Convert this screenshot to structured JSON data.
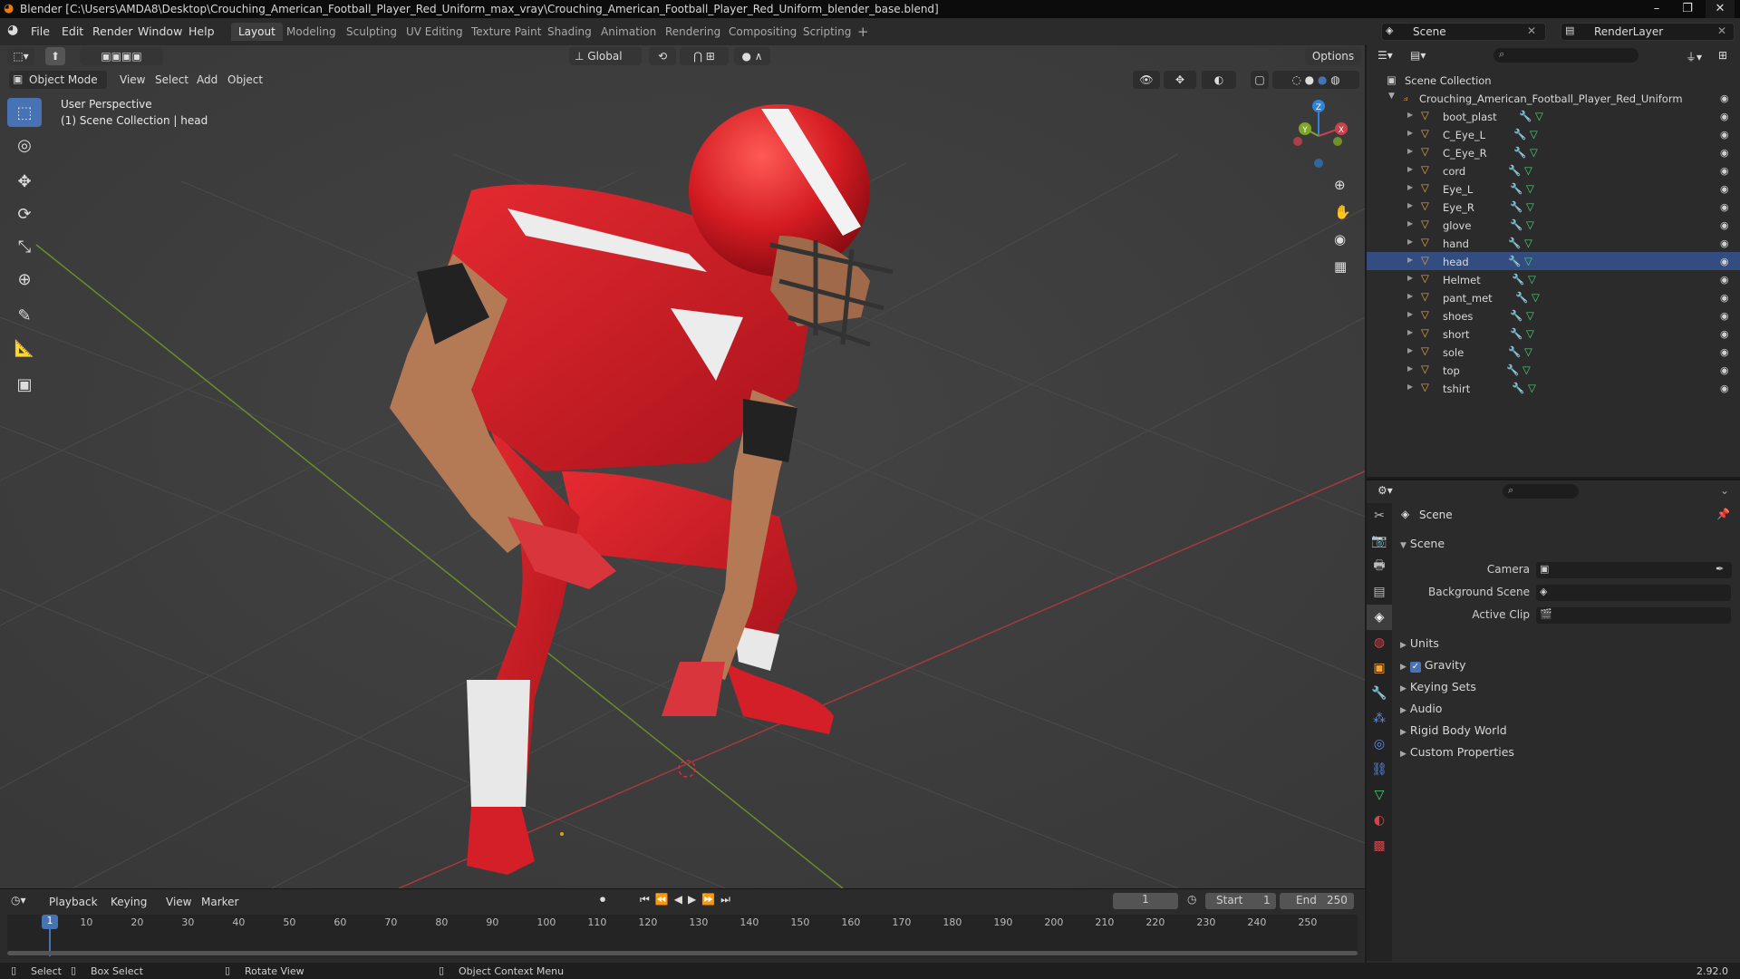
{
  "window": {
    "title": "Blender [C:\\Users\\AMDA8\\Desktop\\Crouching_American_Football_Player_Red_Uniform_max_vray\\Crouching_American_Football_Player_Red_Uniform_blender_base.blend]"
  },
  "menubar": {
    "menus": [
      "File",
      "Edit",
      "Render",
      "Window",
      "Help"
    ],
    "workspaces": [
      "Layout",
      "Modeling",
      "Sculpting",
      "UV Editing",
      "Texture Paint",
      "Shading",
      "Animation",
      "Rendering",
      "Compositing",
      "Scripting"
    ],
    "active_workspace": "Layout",
    "scene_name": "Scene",
    "view_layer": "RenderLayer"
  },
  "viewport_header": {
    "mode": "Object Mode",
    "menus": [
      "View",
      "Select",
      "Add",
      "Object"
    ],
    "orientation": "Global",
    "options": "Options"
  },
  "viewport": {
    "perspective": "User Perspective",
    "collection_info": "(1) Scene Collection | head",
    "gizmo_axes": [
      "X",
      "Y",
      "Z"
    ]
  },
  "outliner": {
    "root": "Scene Collection",
    "collection": "Crouching_American_Football_Player_Red_Uniform",
    "objects": [
      "boot_plast",
      "C_Eye_L",
      "C_Eye_R",
      "cord",
      "Eye_L",
      "Eye_R",
      "glove",
      "hand",
      "head",
      "Helmet",
      "pant_met",
      "shoes",
      "short",
      "sole",
      "top",
      "tshirt"
    ],
    "active_object": "head"
  },
  "properties": {
    "context": "Scene",
    "panel": "Scene",
    "fields": [
      {
        "label": "Camera",
        "value": ""
      },
      {
        "label": "Background Scene",
        "value": ""
      },
      {
        "label": "Active Clip",
        "value": ""
      }
    ],
    "subpanels": [
      "Units",
      "Gravity",
      "Keying Sets",
      "Audio",
      "Rigid Body World",
      "Custom Properties"
    ],
    "gravity_checked": true
  },
  "timeline": {
    "menus": [
      "Playback",
      "Keying",
      "View",
      "Marker"
    ],
    "current_frame": "1",
    "start_label": "Start",
    "start": "1",
    "end_label": "End",
    "end": "250",
    "ruler": [
      "10",
      "20",
      "30",
      "40",
      "50",
      "60",
      "70",
      "80",
      "90",
      "100",
      "110",
      "120",
      "130",
      "140",
      "150",
      "160",
      "170",
      "180",
      "190",
      "200",
      "210",
      "220",
      "230",
      "240",
      "250"
    ],
    "playhead": "1"
  },
  "statusbar": {
    "items": [
      "Select",
      "Box Select",
      "Rotate View",
      "Object Context Menu"
    ],
    "version": "2.92.0"
  },
  "colors": {
    "accent": "#4772b3",
    "uniform_red": "#d8202a",
    "axis_x": "#c8414b",
    "axis_y": "#7ea628",
    "axis_z": "#2f83db"
  }
}
